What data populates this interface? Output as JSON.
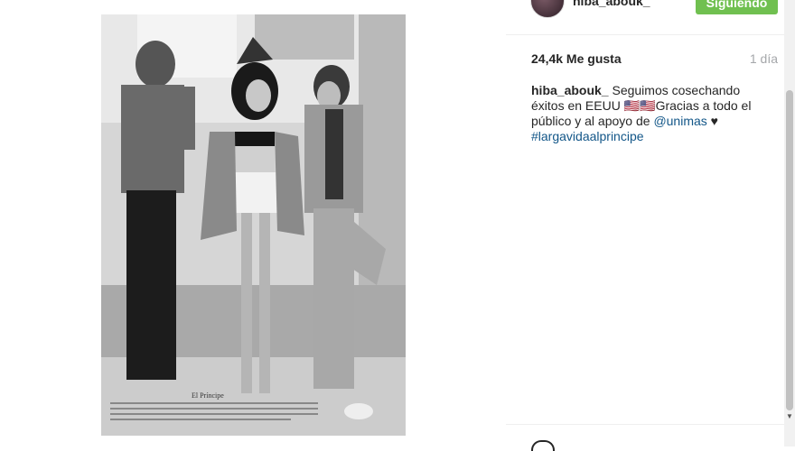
{
  "post": {
    "username": "hiba_abouk_",
    "follow_label": "Siguiendo",
    "likes": "24,4k Me gusta",
    "age": "1 día",
    "caption": {
      "user": "hiba_abouk_",
      "text1": " Seguimos cosechando éxitos en EEUU ",
      "emoji": "🇺🇸🇺🇸",
      "text2": "Gracias a todo el público y al apoyo de ",
      "mention": "@unimas",
      "heart": " ♥",
      "hashtag": "#largavidaalprincipe"
    }
  },
  "photo": {
    "overlay_title": "El Príncipe"
  },
  "colors": {
    "follow": "#70c050",
    "link": "#125688",
    "muted": "#a5a7aa"
  }
}
